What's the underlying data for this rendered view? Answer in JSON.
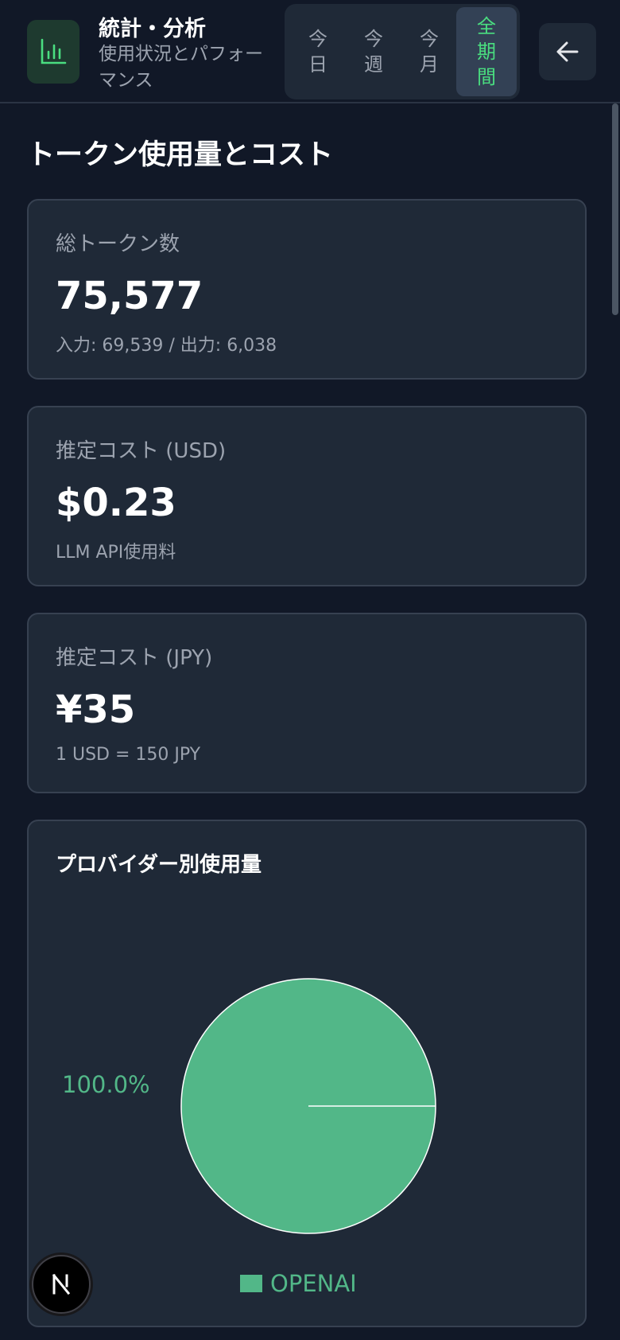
{
  "header": {
    "title": "統計・分析",
    "subtitle": "使用状況とパフォーマンス",
    "periods": [
      "今日",
      "今週",
      "今月",
      "全期間"
    ],
    "active_period": "全期間"
  },
  "section": {
    "title": "トークン使用量とコスト"
  },
  "cards": [
    {
      "label": "総トークン数",
      "value": "75,577",
      "sub": "入力: 69,539 / 出力: 6,038"
    },
    {
      "label": "推定コスト (USD)",
      "value": "$0.23",
      "sub": "LLM API使用料"
    },
    {
      "label": "推定コスト (JPY)",
      "value": "¥35",
      "sub": "1 USD = 150 JPY"
    }
  ],
  "chart_data": {
    "type": "pie",
    "title": "プロバイダー別使用量",
    "categories": [
      "OPENAI"
    ],
    "values": [
      100.0
    ],
    "slice_labels": [
      "100.0%"
    ],
    "colors": [
      "#52b788"
    ],
    "legend": "bottom"
  },
  "icons": {
    "app": "bar-chart-icon",
    "back": "arrow-left-icon",
    "badge": "nextjs-icon"
  },
  "colors": {
    "accent": "#4ade80",
    "pie": "#52b788",
    "background": "#111827",
    "card": "#1f2937"
  }
}
